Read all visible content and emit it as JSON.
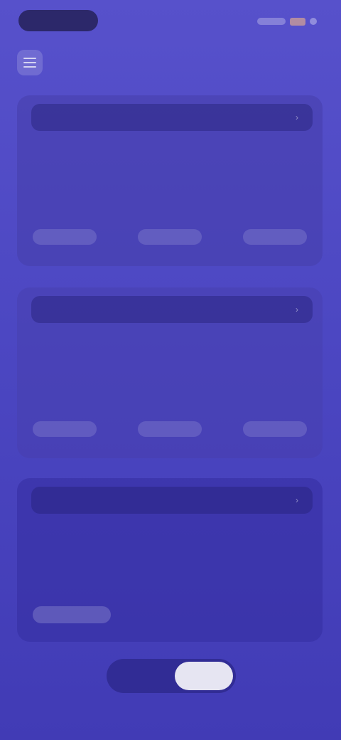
{
  "status_bar": {
    "time": "",
    "battery": ""
  },
  "header": {
    "menu_icon": "menu-icon",
    "title": ""
  },
  "cards": [
    {
      "header_label": "",
      "actions": [
        "",
        "",
        ""
      ]
    },
    {
      "header_label": "",
      "actions": [
        "",
        "",
        ""
      ]
    },
    {
      "header_label": "",
      "link_label": ""
    }
  ],
  "tabs": [
    {
      "label": ""
    },
    {
      "label": ""
    }
  ],
  "colors": {
    "background_top": "#5751cb",
    "background_bottom": "#413bb5",
    "active_tab": "#ffffff",
    "status_pill": "#2c286a"
  }
}
